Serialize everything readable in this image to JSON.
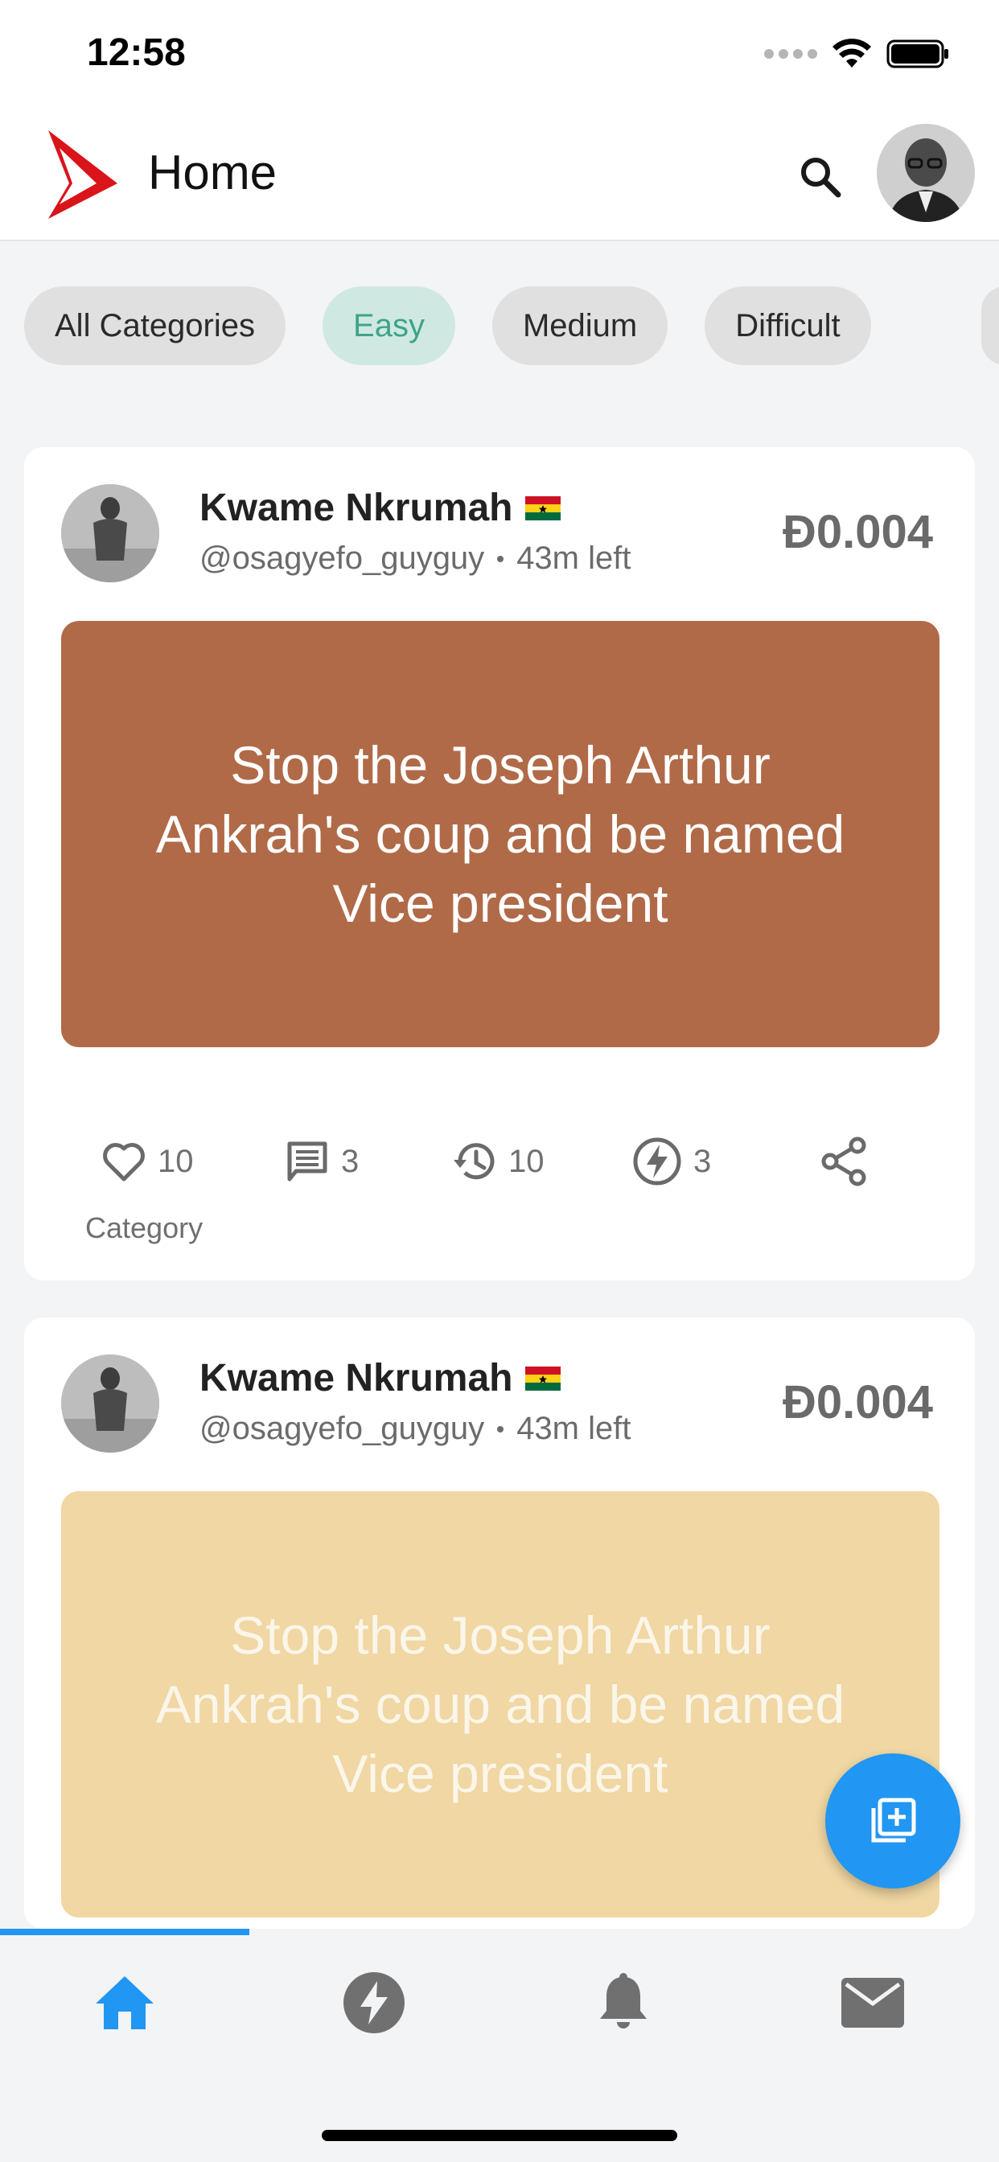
{
  "status_bar": {
    "time": "12:58"
  },
  "app_bar": {
    "title": "Home",
    "logo_icon": "play-logo-icon",
    "search_icon": "search-icon",
    "avatar_icon": "profile-avatar"
  },
  "filters": {
    "items": [
      {
        "label": "All Categories",
        "active": false
      },
      {
        "label": "Easy",
        "active": true
      },
      {
        "label": "Medium",
        "active": false
      },
      {
        "label": "Difficult",
        "active": false
      }
    ]
  },
  "posts": [
    {
      "author_name": "Kwame Nkrumah",
      "flag": "ghana-flag",
      "handle": "@osagyefo_guyguy",
      "time_left": "43m left",
      "price": "Đ0.004",
      "challenge": "Stop the Joseph Arthur Ankrah's coup and be named Vice president",
      "challenge_color": "#b06a48",
      "stats": {
        "likes": "10",
        "comments": "3",
        "history": "10",
        "boosts": "3"
      },
      "category_label": "Category"
    },
    {
      "author_name": "Kwame Nkrumah",
      "flag": "ghana-flag",
      "handle": "@osagyefo_guyguy",
      "time_left": "43m left",
      "price": "Đ0.004",
      "challenge": "Stop the Joseph Arthur Ankrah's coup and be named Vice president",
      "challenge_color": "#f0d7a3"
    }
  ],
  "fab": {
    "icon": "add-post-icon"
  },
  "bottom_nav": {
    "items": [
      {
        "icon": "home-icon",
        "active": true
      },
      {
        "icon": "lightning-icon",
        "active": false
      },
      {
        "icon": "bell-icon",
        "active": false
      },
      {
        "icon": "mail-icon",
        "active": false
      }
    ]
  },
  "colors": {
    "accent": "#2196f3",
    "chip_active_bg": "#cfe9e2",
    "chip_active_text": "#3fa38b",
    "logo_red": "#d9141b"
  }
}
